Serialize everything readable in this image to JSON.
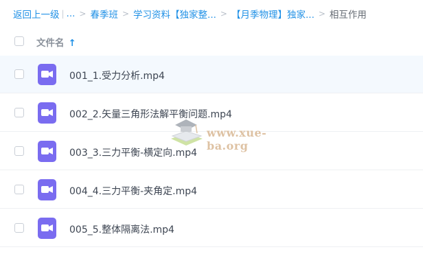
{
  "breadcrumb": {
    "back": "返回上一级",
    "ellipsis": "...",
    "items": [
      "春季班",
      "学习资料【独家整...",
      "【月季物理】独家..."
    ],
    "current": "相互作用"
  },
  "list_header": {
    "name_label": "文件名",
    "sort_arrow": "↑"
  },
  "files": [
    {
      "name": "001_1.受力分析.mp4",
      "icon": "video-icon"
    },
    {
      "name": "002_2.矢量三角形法解平衡问题.mp4",
      "icon": "video-icon"
    },
    {
      "name": "003_3.三力平衡-横定向.mp4",
      "icon": "video-icon"
    },
    {
      "name": "004_4.三力平衡-夹角定.mp4",
      "icon": "video-icon"
    },
    {
      "name": "005_5.整体隔离法.mp4",
      "icon": "video-icon"
    }
  ],
  "watermark": {
    "text": "www.xue-ba.org"
  },
  "colors": {
    "accent": "#1f90e6",
    "video_icon": "#7a6cf0",
    "hover_row": "#f4f9fe"
  }
}
